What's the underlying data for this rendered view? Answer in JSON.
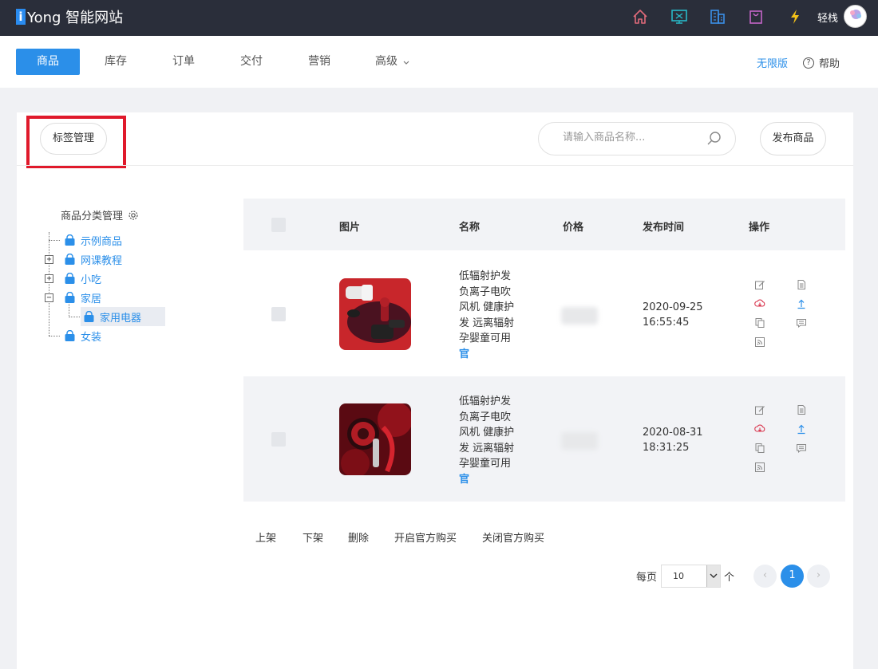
{
  "app": {
    "logo_letter": "i",
    "logo_text": "Yong 智能网站"
  },
  "topbar": {
    "icons": [
      "home-icon",
      "monitor-icon",
      "building-icon",
      "bag-icon",
      "lightning-icon"
    ],
    "user_name": "轻栈",
    "avatar_text": "轻栈"
  },
  "nav": {
    "tabs": [
      {
        "label": "商品",
        "active": true
      },
      {
        "label": "库存"
      },
      {
        "label": "订单"
      },
      {
        "label": "交付"
      },
      {
        "label": "营销"
      },
      {
        "label": "高级"
      }
    ],
    "advanced_chevron": "chevron-down-icon",
    "edition_link": "无限版",
    "help_label": "帮助",
    "help_glyph": "?"
  },
  "toolbar": {
    "tag_manage_label": "标签管理",
    "search_placeholder": "请输入商品名称...",
    "publish_label": "发布商品"
  },
  "tree": {
    "title": "商品分类管理",
    "nodes": [
      {
        "label": "示例商品"
      },
      {
        "label": "网课教程",
        "toggle": "+"
      },
      {
        "label": "小吃",
        "toggle": "+"
      },
      {
        "label": "家居",
        "toggle": "−"
      },
      {
        "label": "家用电器",
        "selected": true
      },
      {
        "label": "女装"
      }
    ]
  },
  "table": {
    "headers": {
      "image": "图片",
      "name": "名称",
      "price": "价格",
      "date": "发布时间",
      "ops": "操作"
    },
    "rows": [
      {
        "name_lines": [
          "低辐射护发",
          "负离子电吹",
          "风机 健康护",
          "发 远离辐射",
          "孕婴童可用"
        ],
        "official": "官",
        "date": "2020-09-25",
        "time": "16:55:45"
      },
      {
        "name_lines": [
          "低辐射护发",
          "负离子电吹",
          "风机 健康护",
          "发 远离辐射",
          "孕婴童可用"
        ],
        "official": "官",
        "date": "2020-08-31",
        "time": "18:31:25"
      }
    ]
  },
  "bulk_actions": [
    "上架",
    "下架",
    "删除",
    "开启官方购买",
    "关闭官方购买"
  ],
  "pager": {
    "per_page_label": "每页",
    "per_page_value": "10",
    "unit_label": "个",
    "prev": "‹",
    "current": "1",
    "next": "›"
  },
  "colors": {
    "accent": "#2b8fe9",
    "topbar": "#2a2e3a",
    "highlight_border": "#e0192b"
  }
}
